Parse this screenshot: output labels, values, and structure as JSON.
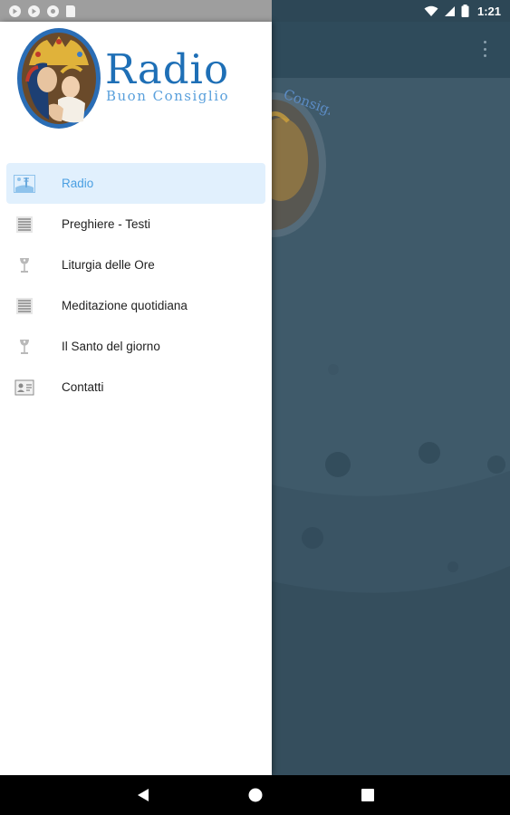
{
  "status_bar": {
    "time": "1:21",
    "left_icons": [
      "play-circle-icon",
      "play-circle-icon",
      "record-icon",
      "sd-card-icon"
    ],
    "right_icons": [
      "wifi-icon",
      "signal-icon",
      "battery-icon"
    ]
  },
  "app": {
    "toolbar_color": "#2f4b5b",
    "background_color": "#3f5a6a",
    "bg_logo_text": "Consiglio"
  },
  "drawer": {
    "logo": {
      "title": "Radio",
      "subtitle": "Buon Consiglio"
    },
    "menu": [
      {
        "label": "Radio",
        "icon": "radio-tower-icon",
        "active": true
      },
      {
        "label": "Preghiere - Testi",
        "icon": "list-icon",
        "active": false
      },
      {
        "label": "Liturgia delle Ore",
        "icon": "chalice-icon",
        "active": false
      },
      {
        "label": "Meditazione quotidiana",
        "icon": "list-icon",
        "active": false
      },
      {
        "label": "Il Santo del giorno",
        "icon": "chalice-icon",
        "active": false
      },
      {
        "label": "Contatti",
        "icon": "contact-card-icon",
        "active": false
      }
    ]
  },
  "nav_bar": {
    "buttons": [
      "back-button",
      "home-button",
      "recents-button"
    ]
  },
  "colors": {
    "accent": "#4a9fe2",
    "active_bg": "#e1f0fd",
    "logo_blue": "#1e6fb6"
  }
}
